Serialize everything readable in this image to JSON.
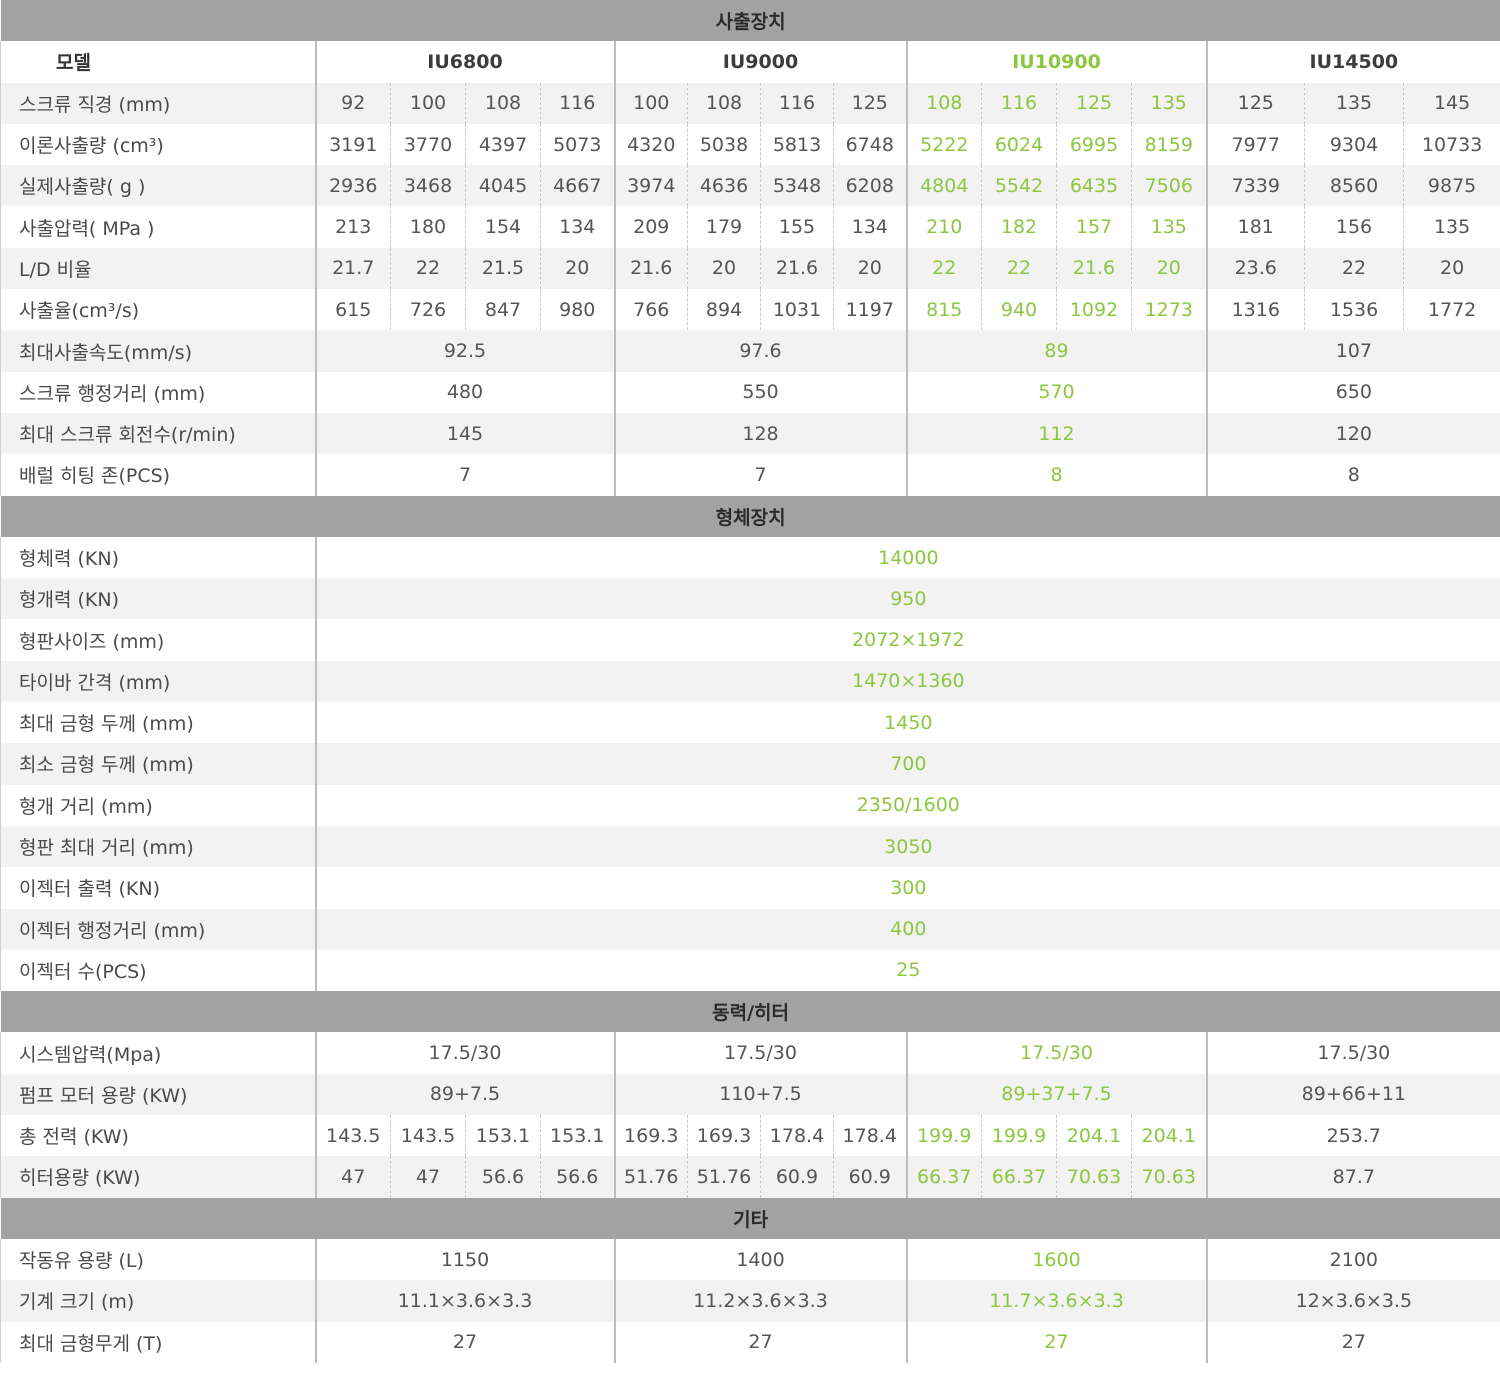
{
  "colors": {
    "highlight": "#8dc63f",
    "section_bg": "#a2a2a2",
    "alt_row_bg": "#f2f2f2"
  },
  "header": {
    "model_label": "모델",
    "models": [
      "IU6800",
      "IU9000",
      "IU10900",
      "IU14500"
    ],
    "highlight_model_index": 2
  },
  "sections": [
    {
      "title": "사출장치",
      "rows": [
        {
          "label": "스크류 직경 (mm)",
          "values": [
            [
              "92",
              "100",
              "108",
              "116"
            ],
            [
              "100",
              "108",
              "116",
              "125"
            ],
            [
              "108",
              "116",
              "125",
              "135"
            ],
            [
              "125",
              "135",
              "145"
            ]
          ]
        },
        {
          "label": "이론사출량 (cm³)",
          "values": [
            [
              "3191",
              "3770",
              "4397",
              "5073"
            ],
            [
              "4320",
              "5038",
              "5813",
              "6748"
            ],
            [
              "5222",
              "6024",
              "6995",
              "8159"
            ],
            [
              "7977",
              "9304",
              "10733"
            ]
          ]
        },
        {
          "label": "실제사출량( g )",
          "values": [
            [
              "2936",
              "3468",
              "4045",
              "4667"
            ],
            [
              "3974",
              "4636",
              "5348",
              "6208"
            ],
            [
              "4804",
              "5542",
              "6435",
              "7506"
            ],
            [
              "7339",
              "8560",
              "9875"
            ]
          ]
        },
        {
          "label": "사출압력( MPa )",
          "values": [
            [
              "213",
              "180",
              "154",
              "134"
            ],
            [
              "209",
              "179",
              "155",
              "134"
            ],
            [
              "210",
              "182",
              "157",
              "135"
            ],
            [
              "181",
              "156",
              "135"
            ]
          ]
        },
        {
          "label": "L/D 비율",
          "values": [
            [
              "21.7",
              "22",
              "21.5",
              "20"
            ],
            [
              "21.6",
              "20",
              "21.6",
              "20"
            ],
            [
              "22",
              "22",
              "21.6",
              "20"
            ],
            [
              "23.6",
              "22",
              "20"
            ]
          ]
        },
        {
          "label": "사출율(cm³/s)",
          "values": [
            [
              "615",
              "726",
              "847",
              "980"
            ],
            [
              "766",
              "894",
              "1031",
              "1197"
            ],
            [
              "815",
              "940",
              "1092",
              "1273"
            ],
            [
              "1316",
              "1536",
              "1772"
            ]
          ]
        },
        {
          "label": "최대사출속도(mm/s)",
          "values": [
            [
              "92.5"
            ],
            [
              "97.6"
            ],
            [
              "89"
            ],
            [
              "107"
            ]
          ]
        },
        {
          "label": "스크류 행정거리 (mm)",
          "values": [
            [
              "480"
            ],
            [
              "550"
            ],
            [
              "570"
            ],
            [
              "650"
            ]
          ]
        },
        {
          "label": "최대 스크류 회전수(r/min)",
          "values": [
            [
              "145"
            ],
            [
              "128"
            ],
            [
              "112"
            ],
            [
              "120"
            ]
          ]
        },
        {
          "label": "배럴 히팅 존(PCS)",
          "values": [
            [
              "7"
            ],
            [
              "7"
            ],
            [
              "8"
            ],
            [
              "8"
            ]
          ]
        }
      ]
    },
    {
      "title": "형체장치",
      "rows": [
        {
          "label": "형체력 (KN)",
          "value": "14000"
        },
        {
          "label": "형개력 (KN)",
          "value": "950"
        },
        {
          "label": "형판사이즈 (mm)",
          "value": "2072×1972"
        },
        {
          "label": "타이바 간격 (mm)",
          "value": "1470×1360"
        },
        {
          "label": "최대 금형 두께 (mm)",
          "value": "1450"
        },
        {
          "label": "최소 금형 두께 (mm)",
          "value": "700"
        },
        {
          "label": "형개 거리 (mm)",
          "value": "2350/1600"
        },
        {
          "label": "형판 최대 거리 (mm)",
          "value": "3050"
        },
        {
          "label": "이젝터 출력 (KN)",
          "value": "300"
        },
        {
          "label": "이젝터 행정거리 (mm)",
          "value": "400"
        },
        {
          "label": "이젝터 수(PCS)",
          "value": "25"
        }
      ]
    },
    {
      "title": "동력/히터",
      "rows": [
        {
          "label": "시스템압력(Mpa)",
          "values": [
            [
              "17.5/30"
            ],
            [
              "17.5/30"
            ],
            [
              "17.5/30"
            ],
            [
              "17.5/30"
            ]
          ]
        },
        {
          "label": "펌프 모터 용량 (KW)",
          "values": [
            [
              "89+7.5"
            ],
            [
              "110+7.5"
            ],
            [
              "89+37+7.5"
            ],
            [
              "89+66+11"
            ]
          ]
        },
        {
          "label": "총 전력 (KW)",
          "values": [
            [
              "143.5",
              "143.5",
              "153.1",
              "153.1"
            ],
            [
              "169.3",
              "169.3",
              "178.4",
              "178.4"
            ],
            [
              "199.9",
              "199.9",
              "204.1",
              "204.1"
            ],
            [
              "253.7"
            ]
          ]
        },
        {
          "label": "히터용량 (KW)",
          "values": [
            [
              "47",
              "47",
              "56.6",
              "56.6"
            ],
            [
              "51.76",
              "51.76",
              "60.9",
              "60.9"
            ],
            [
              "66.37",
              "66.37",
              "70.63",
              "70.63"
            ],
            [
              "87.7"
            ]
          ]
        }
      ]
    },
    {
      "title": "기타",
      "rows": [
        {
          "label": "작동유 용량 (L)",
          "values": [
            [
              "1150"
            ],
            [
              "1400"
            ],
            [
              "1600"
            ],
            [
              "2100"
            ]
          ]
        },
        {
          "label": "기계 크기 (m)",
          "values": [
            [
              "11.1×3.6×3.3"
            ],
            [
              "11.2×3.6×3.3"
            ],
            [
              "11.7×3.6×3.3"
            ],
            [
              "12×3.6×3.5"
            ]
          ]
        },
        {
          "label": "최대 금형무게 (T)",
          "values": [
            [
              "27"
            ],
            [
              "27"
            ],
            [
              "27"
            ],
            [
              "27"
            ]
          ]
        }
      ]
    }
  ]
}
